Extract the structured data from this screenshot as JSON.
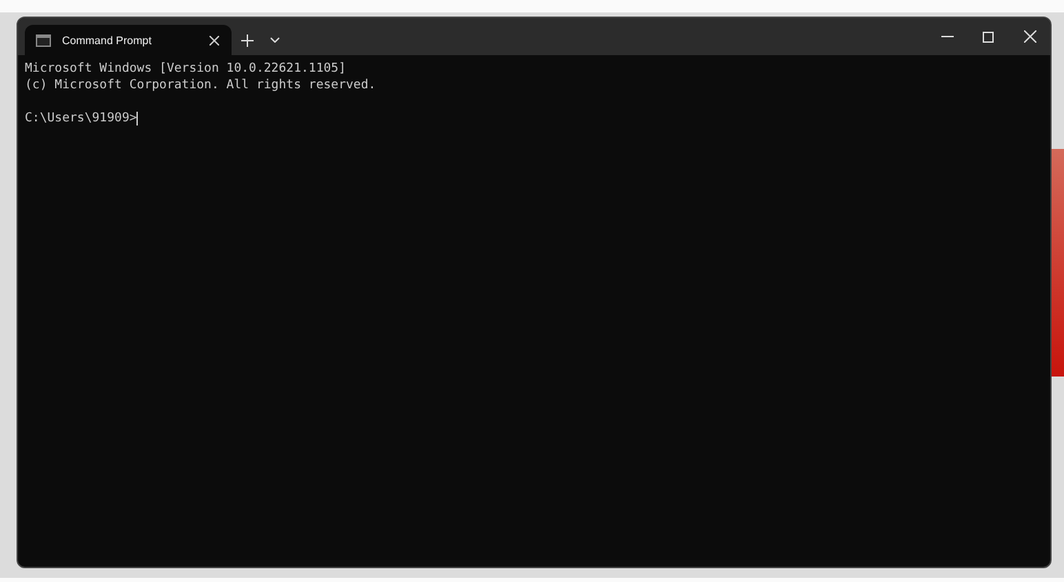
{
  "tabs": [
    {
      "label": "Command Prompt",
      "selected": true
    }
  ],
  "console": {
    "banner": [
      "Microsoft Windows [Version 10.0.22621.1105]",
      "(c) Microsoft Corporation. All rights reserved."
    ],
    "prompt": "C:\\Users\\91909>",
    "cursor": true
  }
}
